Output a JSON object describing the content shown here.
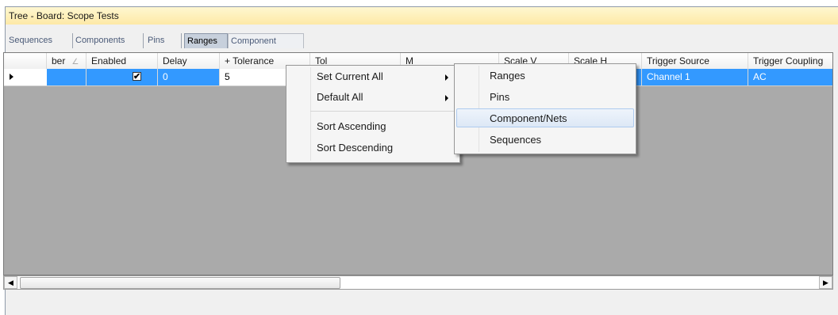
{
  "window": {
    "title": "Tree - Board: Scope Tests"
  },
  "tabs": [
    {
      "label": "Sequences"
    },
    {
      "label": "Components"
    },
    {
      "label": "Pins"
    },
    {
      "label": "Ranges"
    },
    {
      "label": "Component Scans"
    }
  ],
  "grid": {
    "columns": [
      "ber",
      "Enabled",
      "Delay",
      "+ Tolerance",
      "Tol",
      "M",
      "Scale V",
      "Scale H",
      "Trigger Source",
      "Trigger Coupling"
    ],
    "row": {
      "enabled": "✔",
      "delay": "0",
      "tolerance": "5",
      "trigger_source": "Channel 1",
      "trigger_coupling": "AC"
    }
  },
  "context_menu": {
    "items": [
      {
        "label": "Set Current All",
        "submenu": true
      },
      {
        "label": "Default All",
        "submenu": true
      },
      {
        "label": "Sort Ascending"
      },
      {
        "label": "Sort Descending"
      }
    ]
  },
  "submenu": {
    "items": [
      {
        "label": "Ranges"
      },
      {
        "label": "Pins"
      },
      {
        "label": "Component/Nets",
        "highlighted": true
      },
      {
        "label": "Sequences"
      }
    ]
  },
  "scrollbar": {
    "left_icon": "◀",
    "right_icon": "▶"
  }
}
